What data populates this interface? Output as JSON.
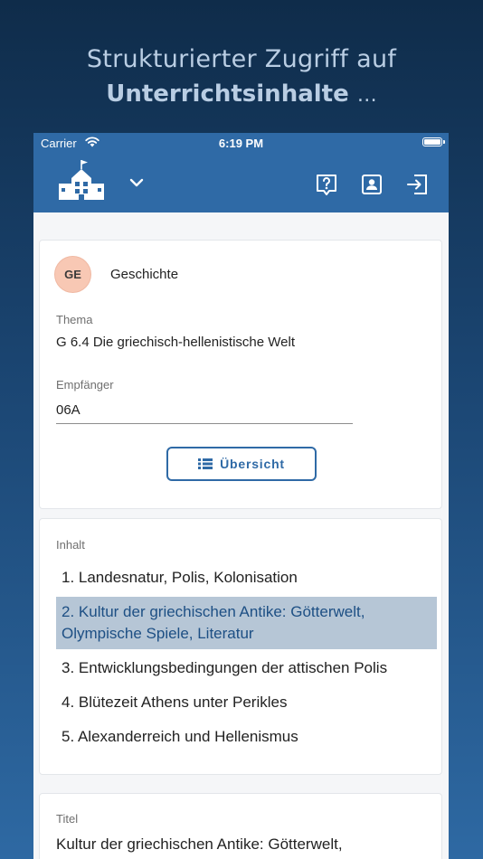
{
  "headline": {
    "line1": "Strukturierter Zugriff auf",
    "line2": "Unterrichtsinhalte",
    "ellipsis": "…"
  },
  "statusbar": {
    "carrier": "Carrier",
    "time": "6:19 PM"
  },
  "toolbar": {
    "icons": [
      "school-icon",
      "chevron-down-icon",
      "help-icon",
      "contact-card-icon",
      "logout-icon"
    ]
  },
  "lesson": {
    "avatar": "GE",
    "subject": "Geschichte",
    "thema_label": "Thema",
    "thema_value": "G 6.4 Die griechisch-hellenistische Welt",
    "empfaenger_label": "Empfänger",
    "empfaenger_value": "06A",
    "ubersicht_label": "Übersicht"
  },
  "content": {
    "label": "Inhalt",
    "items": [
      "1. Landesnatur, Polis, Kolonisation",
      "2. Kultur der griechischen Antike: Götterwelt, Olympische Spiele, Literatur",
      "3. Entwicklungsbedingungen der attischen Polis",
      "4. Blütezeit Athens unter Perikles",
      "5. Alexanderreich und Hellenismus"
    ],
    "selected_index": 1
  },
  "title_card": {
    "label": "Titel",
    "value": "Kultur der griechischen Antike: Götterwelt, Olympische Spiele, Literatur"
  },
  "colors": {
    "primary": "#2f6aa6",
    "selected_bg": "#b6c6d6",
    "avatar_bg": "#f8c8b4"
  }
}
